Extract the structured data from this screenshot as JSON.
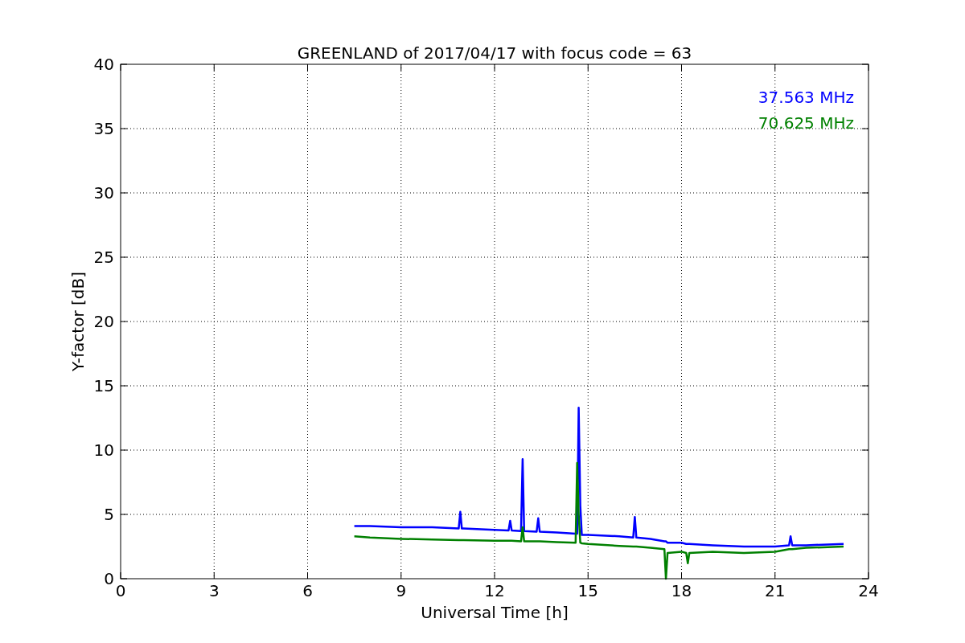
{
  "chart_data": {
    "type": "line",
    "title": "GREENLAND of 2017/04/17 with focus code = 63",
    "xlabel": "Universal Time [h]",
    "ylabel": "Y-factor [dB]",
    "x": [
      7.5,
      8,
      9,
      10,
      10.85,
      10.9,
      10.95,
      11,
      12,
      12.45,
      12.5,
      12.55,
      12.85,
      12.9,
      12.95,
      13.35,
      13.4,
      13.45,
      14,
      14.6,
      14.65,
      14.7,
      14.75,
      14.8,
      15,
      16,
      16.45,
      16.5,
      16.55,
      17,
      17.45,
      17.5,
      17.55,
      18,
      18.15,
      18.2,
      18.25,
      19,
      20,
      21,
      21.45,
      21.5,
      21.55,
      22,
      23.2
    ],
    "series": [
      {
        "name": "37.563 MHz",
        "color": "#0000ff",
        "values": [
          4.1,
          4.1,
          4.0,
          4.0,
          3.9,
          5.2,
          3.9,
          3.9,
          3.8,
          3.75,
          4.5,
          3.75,
          3.7,
          9.3,
          3.7,
          3.65,
          4.7,
          3.65,
          3.6,
          3.5,
          3.5,
          13.3,
          5.7,
          3.4,
          3.4,
          3.3,
          3.2,
          4.8,
          3.2,
          3.1,
          2.9,
          2.9,
          2.8,
          2.8,
          2.7,
          2.7,
          2.7,
          2.6,
          2.5,
          2.5,
          2.6,
          3.3,
          2.6,
          2.6,
          2.7
        ]
      },
      {
        "name": "70.625 MHz",
        "color": "#008000",
        "values": [
          3.3,
          3.2,
          3.1,
          3.05,
          3.0,
          3.0,
          3.0,
          3.0,
          2.95,
          2.95,
          2.95,
          2.95,
          2.9,
          4.0,
          2.9,
          2.9,
          2.9,
          2.9,
          2.85,
          2.8,
          9.0,
          5.0,
          2.8,
          2.75,
          2.7,
          2.55,
          2.5,
          2.5,
          2.5,
          2.4,
          2.3,
          0,
          2.0,
          2.1,
          2.0,
          1.2,
          2.0,
          2.1,
          2.0,
          2.1,
          2.3,
          2.3,
          2.3,
          2.4,
          2.5
        ]
      }
    ],
    "grid": true,
    "xlim": [
      0,
      24
    ],
    "ylim": [
      0,
      40
    ],
    "xticks": [
      0,
      3,
      6,
      9,
      12,
      15,
      18,
      21,
      24
    ],
    "yticks": [
      0,
      5,
      10,
      15,
      20,
      25,
      30,
      35,
      40
    ]
  }
}
